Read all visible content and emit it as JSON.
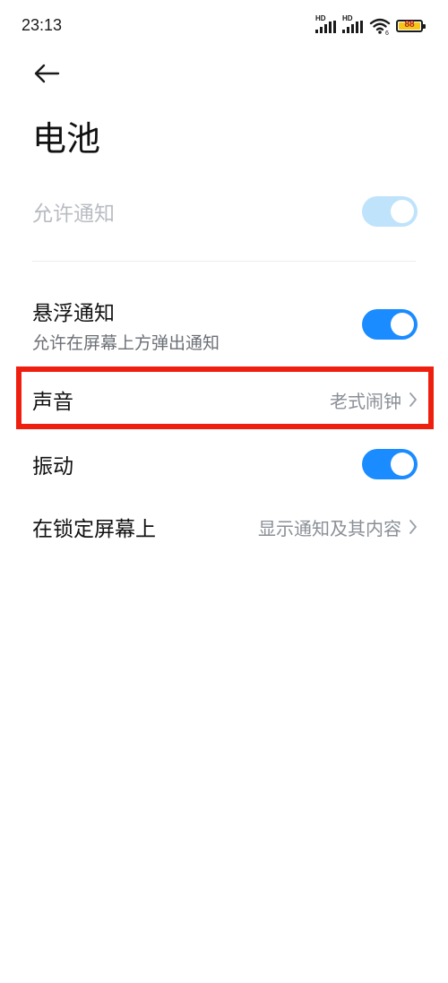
{
  "status_bar": {
    "time": "23:13",
    "signal_1_label": "HD",
    "signal_2_label": "HD",
    "battery_level": "88",
    "battery_color": "#f5c518"
  },
  "page": {
    "title": "电池"
  },
  "settings": {
    "allow_notifications": {
      "label": "允许通知",
      "enabled": false,
      "toggle_on": true
    },
    "floating_notifications": {
      "label": "悬浮通知",
      "sublabel": "允许在屏幕上方弹出通知",
      "toggle_on": true
    },
    "sound": {
      "label": "声音",
      "value": "老式闹钟",
      "highlighted": true
    },
    "vibration": {
      "label": "振动",
      "toggle_on": true
    },
    "lock_screen": {
      "label": "在锁定屏幕上",
      "value": "显示通知及其内容"
    }
  },
  "colors": {
    "toggle_on": "#1a8cff",
    "toggle_disabled": "#bfe3fb",
    "highlight": "#ef1f10"
  }
}
